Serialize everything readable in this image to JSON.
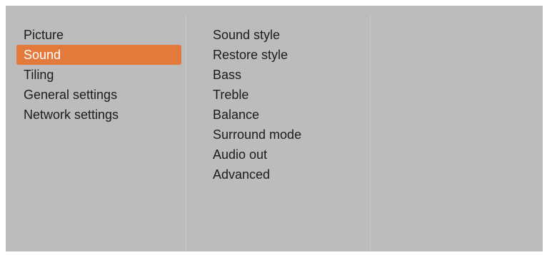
{
  "colors": {
    "panel_background": "#bcbcbc",
    "selection_highlight": "#e4793c",
    "text": "#1c1c1c",
    "selected_text": "#ffffff"
  },
  "main_menu": {
    "selected_index": 1,
    "items": [
      {
        "label": "Picture"
      },
      {
        "label": "Sound"
      },
      {
        "label": "Tiling"
      },
      {
        "label": "General settings"
      },
      {
        "label": "Network settings"
      }
    ]
  },
  "sound_submenu": {
    "items": [
      {
        "label": "Sound style"
      },
      {
        "label": "Restore style"
      },
      {
        "label": "Bass"
      },
      {
        "label": "Treble"
      },
      {
        "label": "Balance"
      },
      {
        "label": "Surround mode"
      },
      {
        "label": "Audio out"
      },
      {
        "label": "Advanced"
      }
    ]
  }
}
